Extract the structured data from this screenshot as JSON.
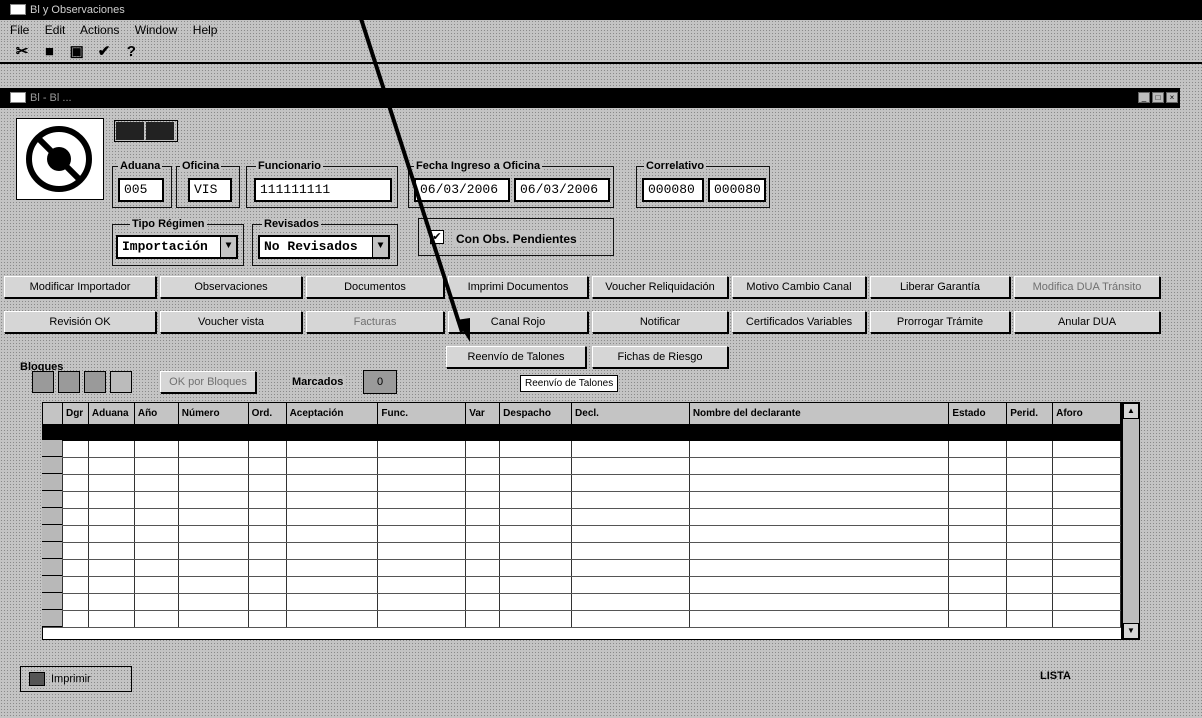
{
  "window": {
    "title": "Bl y Observaciones"
  },
  "menu": [
    "File",
    "Edit",
    "Actions",
    "Window",
    "Help"
  ],
  "toolbar": {
    "icons": [
      "cut-icon",
      "copy-icon",
      "paste-icon",
      "check-icon",
      "help-icon"
    ]
  },
  "child": {
    "title": "Bl - Bl ..."
  },
  "filters": {
    "aduana_label": "Aduana",
    "aduana": "005",
    "oficina_label": "Oficina",
    "oficina": "VIS",
    "funcionario_label": "Funcionario",
    "funcionario": "111111111",
    "fecha_label": "Fecha Ingreso a Oficina",
    "fecha_desde": "06/03/2006",
    "fecha_hasta": "06/03/2006",
    "correlativo_label": "Correlativo",
    "correlativo_desde": "000080",
    "correlativo_hasta": "000080",
    "regimen_label": "Tipo Régimen",
    "regimen": "Importación",
    "revisados_label": "Revisados",
    "revisados": "No Revisados",
    "pendientes_label": "Con Obs. Pendientes"
  },
  "buttons_row1": [
    "Modificar Importador",
    "Observaciones",
    "Documentos",
    "Imprimi Documentos",
    "Voucher Reliquidación",
    "Motivo Cambio Canal",
    "Liberar Garantía",
    "Modifica DUA Tránsito"
  ],
  "buttons_row2": [
    "Revisión OK",
    "Voucher vista",
    "Facturas",
    "Canal Rojo",
    "Notificar",
    "Certificados Variables",
    "Prorrogar Trámite",
    "Anular DUA"
  ],
  "buttons_row3": [
    "Reenvío de Talones",
    "Fichas de Riesgo"
  ],
  "tooltip": "Reenvío de Talones",
  "bloques": {
    "label": "Bloques",
    "ok_button": "OK por Bloques",
    "marcados_label": "Marcados",
    "marcados": "0"
  },
  "grid": {
    "columns": [
      "Dgr",
      "Aduana",
      "Año",
      "Número",
      "Ord.",
      "Aceptación",
      "Func.",
      "Var",
      "Despacho",
      "Decl.",
      "Nombre del declarante",
      "Estado",
      "Perid.",
      "Aforo"
    ]
  },
  "footer": {
    "print_label": "Imprimir",
    "status": "LISTA"
  }
}
